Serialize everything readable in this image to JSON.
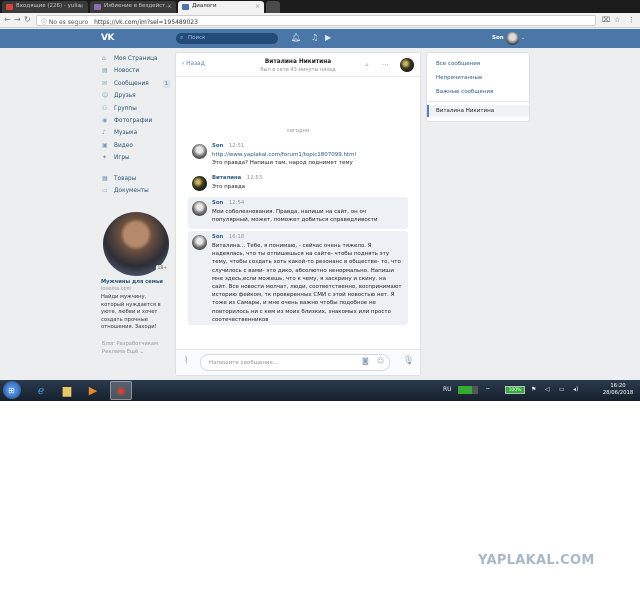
{
  "browser": {
    "tabs": [
      {
        "label": "Входящие (226) - yulia",
        "icon": "gmail-icon",
        "active": false
      },
      {
        "label": "Избиение в бездейст...",
        "icon": "yaplakal-icon",
        "active": false
      },
      {
        "label": "Диалоги",
        "icon": "vk-icon",
        "active": true
      }
    ],
    "security_label": "No es seguro",
    "url": "https://vk.com/im?sel=195489023"
  },
  "header": {
    "logo": "VK",
    "search_placeholder": "Поиск",
    "user_name": "Son"
  },
  "sidebar": {
    "items": [
      {
        "label": "Моя Страница",
        "icon": "home-icon"
      },
      {
        "label": "Новости",
        "icon": "news-icon"
      },
      {
        "label": "Сообщения",
        "icon": "chat-icon",
        "badge": "1"
      },
      {
        "label": "Друзья",
        "icon": "friends-icon"
      },
      {
        "label": "Группы",
        "icon": "groups-icon"
      },
      {
        "label": "Фотографии",
        "icon": "camera-icon"
      },
      {
        "label": "Музыка",
        "icon": "music-icon"
      },
      {
        "label": "Видео",
        "icon": "video-icon"
      },
      {
        "label": "Игры",
        "icon": "games-icon"
      }
    ],
    "items2": [
      {
        "label": "Товары",
        "icon": "shop-icon"
      },
      {
        "label": "Документы",
        "icon": "docs-icon"
      }
    ],
    "ad": {
      "age": "18+",
      "title": "Мужчины для семьи",
      "site": "loveina.com",
      "text": "Найди мужчину, который нуждается в уюте, любви и хочет создать прочные отношения. Заходи!"
    },
    "footer": {
      "line1": "Блог   Разработчикам",
      "line2": "Реклама   Ещё ⌄"
    }
  },
  "chat": {
    "back_label": "Назад",
    "name": "Виталина Никитина",
    "status": "был в сети 43 минуты назад",
    "day_separator": "сегодня",
    "messages": [
      {
        "author": "Son",
        "time": "12:51",
        "link": "http://www.yaplakal.com/forum1/topic1807099.html",
        "text": "Это правда? Напиши там, народ поднимет тему"
      },
      {
        "author": "Виталина",
        "time": "12:53",
        "text": "Это правда"
      },
      {
        "author": "Son",
        "time": "12:54",
        "text": "Мои соболезнования. Правда, напиши на сайт, он оч популярный, может, поможет добиться справедливости"
      },
      {
        "author": "Son",
        "time": "16:18",
        "text": "Виталина... Тебе, я понимаю, - сейчас очень тяжело. Я надеялась, что ты отпишешься на сайте- чтобы поднять эту тему, чтобы создать хоть какой-то резонанс в обществе- то, что случилось с вами- это дико, абсолютно ненормально. Напиши мне здесь,если можешь, что к чему, я заскрину и скину. на сайт. Все новости молчат, люди, соответственно, воспринимают историю фейком, тк проверенных СМИ с этой новостью нет. Я тоже из Самары, и мне очень важно чтобы подобное не повторилось ни с кем из моих близких, знакомых или просто соотечественников"
      }
    ],
    "composer_placeholder": "Напишите сообщение..."
  },
  "right_panel": {
    "items": [
      "Все сообщения",
      "Непрочитанные",
      "Важные сообщения"
    ],
    "selected": "Виталина Никитина"
  },
  "taskbar": {
    "lang": "RU",
    "battery": "100%",
    "time": "16:20",
    "date": "28/06/2018"
  },
  "watermark": "YAPLAKAL.COM",
  "colors": {
    "vk_blue": "#4a76a8",
    "link": "#2a5885",
    "bg": "#edeef0"
  }
}
